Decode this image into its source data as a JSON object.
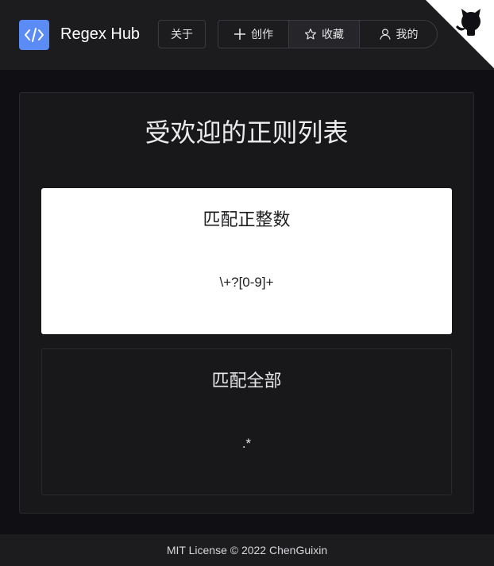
{
  "header": {
    "brand": "Regex Hub",
    "about_label": "关于",
    "create_label": "创作",
    "favorites_label": "收藏",
    "mine_label": "我的"
  },
  "main": {
    "title": "受欢迎的正则列表",
    "cards": [
      {
        "title": "匹配正整数",
        "pattern": "\\+?[0-9]+"
      },
      {
        "title": "匹配全部",
        "pattern": ".*"
      }
    ]
  },
  "footer": {
    "text": "MIT License © 2022 ChenGuixin"
  },
  "colors": {
    "accent": "#5b8cf6",
    "background": "#101014",
    "surface": "#18181b",
    "header": "#1c1c1f"
  },
  "icons": [
    "code-icon",
    "plus-icon",
    "star-icon",
    "user-icon",
    "github-icon"
  ]
}
